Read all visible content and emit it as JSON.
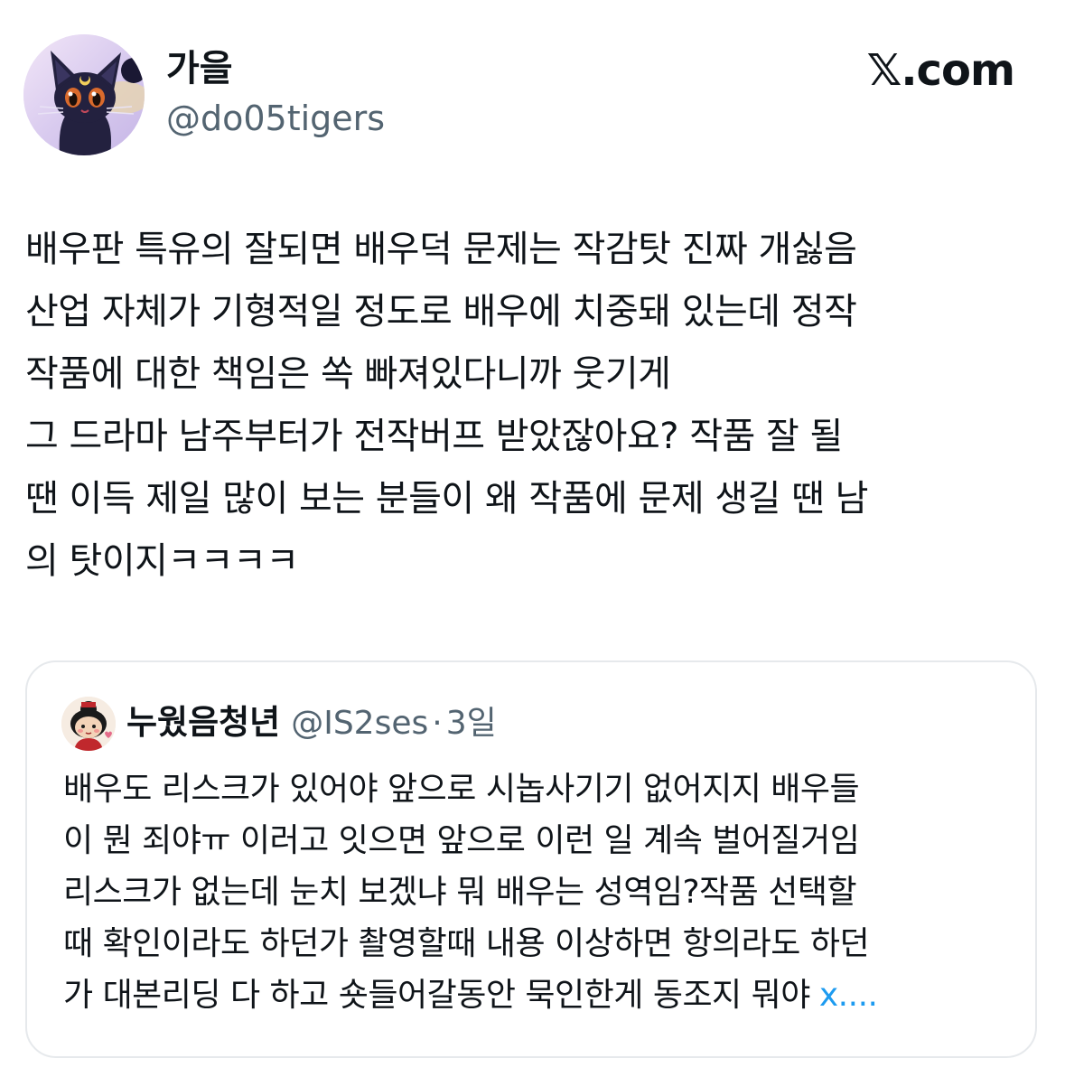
{
  "author": {
    "display_name": "가을",
    "handle": "@do05tigers"
  },
  "brand": {
    "label": "𝕏.com"
  },
  "tweet": {
    "lines": [
      "배우판 특유의 잘되면 배우덕 문제는 작감탓 진짜 개싫음",
      "산업 자체가 기형적일 정도로 배우에 치중돼 있는데 정작",
      "작품에 대한 책임은 쏙 빠져있다니까 웃기게",
      "그 드라마 남주부터가 전작버프 받았잖아요? 작품 잘 될",
      "땐 이득 제일 많이 보는 분들이 왜 작품에 문제 생길 땐 남",
      "의 탓이지ㅋㅋㅋㅋ"
    ]
  },
  "quote": {
    "display_name": "누웠음청년",
    "handle": "@IS2ses",
    "separator": "·",
    "time": "3일",
    "lines": [
      "배우도 리스크가 있어야 앞으로 시놉사기기 없어지지 배우들",
      "이 뭔 죄야ㅠ 이러고 잇으면 앞으로 이런 일 계속 벌어질거임",
      "리스크가 없는데 눈치 보겠냐 뭐 배우는 성역임?작품 선택할",
      "때 확인이라도 하던가 촬영할때 내용 이상하면 항의라도 하던",
      "가 대본리딩 다 하고 숏들어갈동안 묵인한게 동조지 뭐야"
    ],
    "more_link": "x...."
  },
  "colors": {
    "text": "#0f1419",
    "secondary": "#536471",
    "link": "#1d9bf0",
    "border": "#e6e9ec"
  },
  "icons": {
    "author_avatar": "black-cat-avatar-icon",
    "quote_avatar": "cartoon-girl-avatar-icon"
  }
}
